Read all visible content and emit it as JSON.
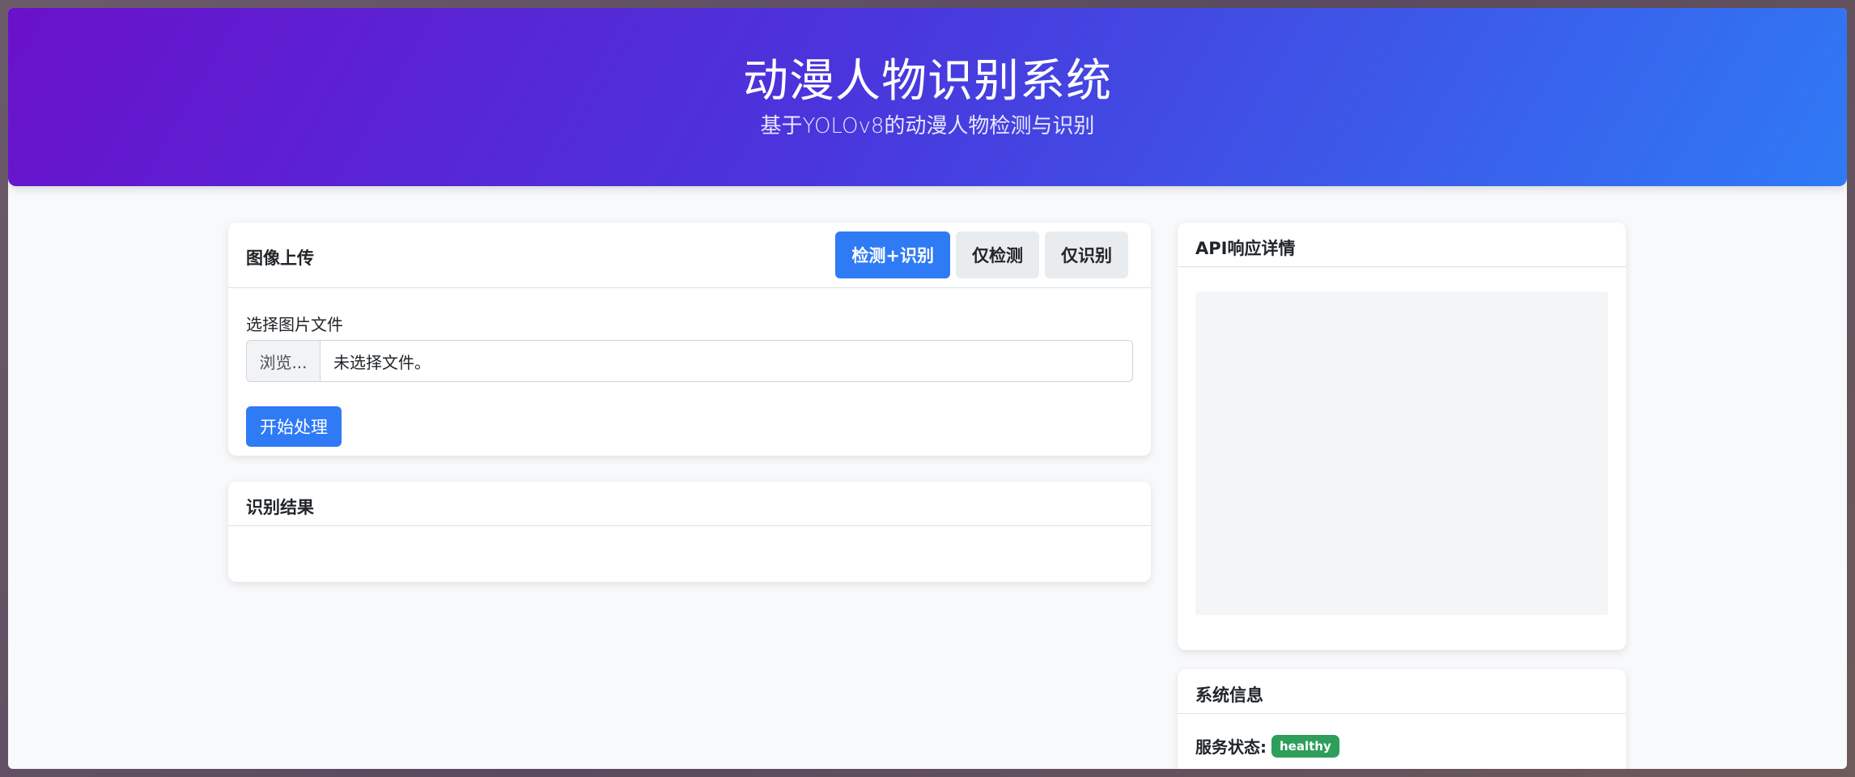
{
  "header": {
    "title": "动漫人物识别系统",
    "subtitle": "基于YOLOv8的动漫人物检测与识别"
  },
  "upload": {
    "title": "图像上传",
    "modes": [
      {
        "label": "检测+识别",
        "active": true
      },
      {
        "label": "仅检测",
        "active": false
      },
      {
        "label": "仅识别",
        "active": false
      }
    ],
    "file_label": "选择图片文件",
    "browse_label": "浏览...",
    "file_value": "未选择文件。",
    "start_label": "开始处理"
  },
  "results": {
    "title": "识别结果"
  },
  "api": {
    "title": "API响应详情"
  },
  "system": {
    "title": "系统信息",
    "status_label": "服务状态:",
    "status_value": "healthy"
  },
  "colors": {
    "primary": "#2f7af5",
    "header_start": "#6a11cb",
    "header_end": "#2f7af5",
    "status_healthy": "#2e9e5b"
  }
}
